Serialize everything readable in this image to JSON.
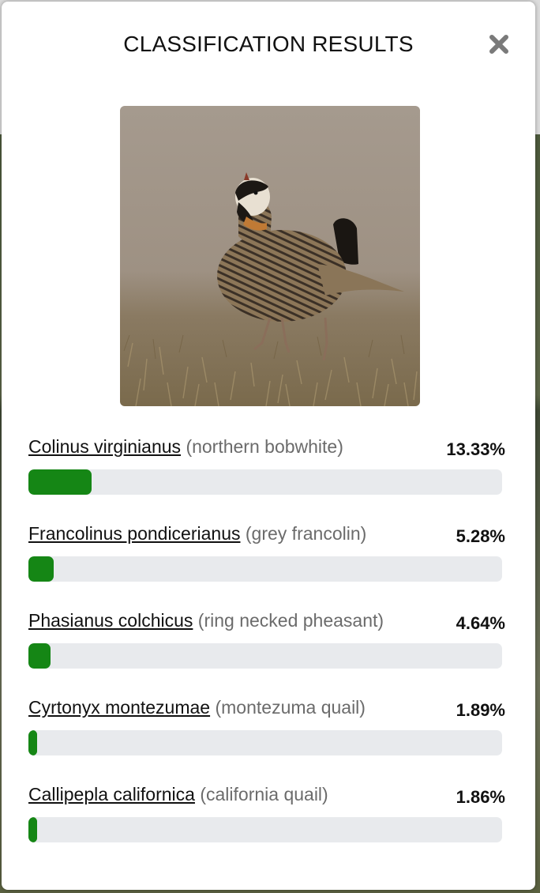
{
  "modal": {
    "title": "CLASSIFICATION RESULTS",
    "close_icon": "close-icon"
  },
  "image": {
    "subject": "bird-photo"
  },
  "colors": {
    "bar_fill": "#158615",
    "bar_track": "#e8eaed"
  },
  "results": [
    {
      "scientific": "Colinus virginianus",
      "common": "(northern bobwhite)",
      "percent": "13.33%",
      "value": 13.33
    },
    {
      "scientific": "Francolinus pondicerianus",
      "common": "(grey francolin)",
      "percent": "5.28%",
      "value": 5.28
    },
    {
      "scientific": "Phasianus colchicus",
      "common": "(ring necked pheasant)",
      "percent": "4.64%",
      "value": 4.64
    },
    {
      "scientific": "Cyrtonyx montezumae",
      "common": "(montezuma quail)",
      "percent": "1.89%",
      "value": 1.89
    },
    {
      "scientific": "Callipepla californica",
      "common": "(california quail)",
      "percent": "1.86%",
      "value": 1.86
    }
  ]
}
